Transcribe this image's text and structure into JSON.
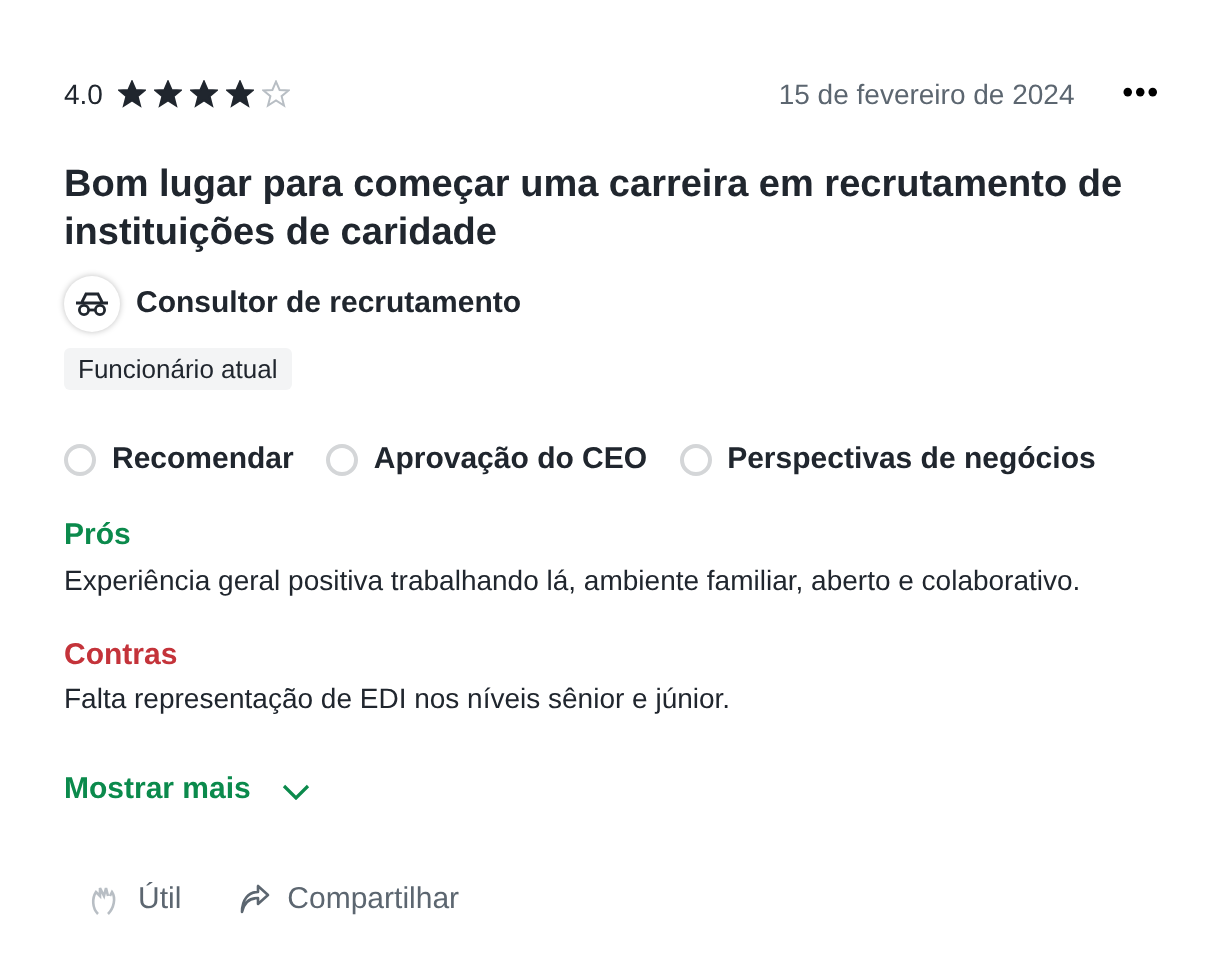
{
  "rating": {
    "value": "4.0",
    "stars": 4
  },
  "date": "15 de fevereiro de 2024",
  "menu_button": "•••",
  "title": "Bom lugar para começar uma carreira em recrutamento de instituições de caridade",
  "job_title": "Consultor de recrutamento",
  "employment_tag": "Funcionário atual",
  "indicators": [
    {
      "label": "Recomendar"
    },
    {
      "label": "Aprovação do CEO"
    },
    {
      "label": "Perspectivas de negócios"
    }
  ],
  "sections": [
    {
      "kind": "pros",
      "heading": "Prós",
      "text": "Experiência geral positiva trabalhando lá, ambiente familiar, aberto e colaborativo."
    },
    {
      "kind": "cons",
      "heading": "Contras",
      "text": "Falta representação de EDI nos níveis sênior e júnior."
    }
  ],
  "show_more": "Mostrar mais",
  "actions": [
    {
      "kind": "helpful",
      "label": "Útil"
    },
    {
      "kind": "share",
      "label": "Compartilhar"
    }
  ]
}
